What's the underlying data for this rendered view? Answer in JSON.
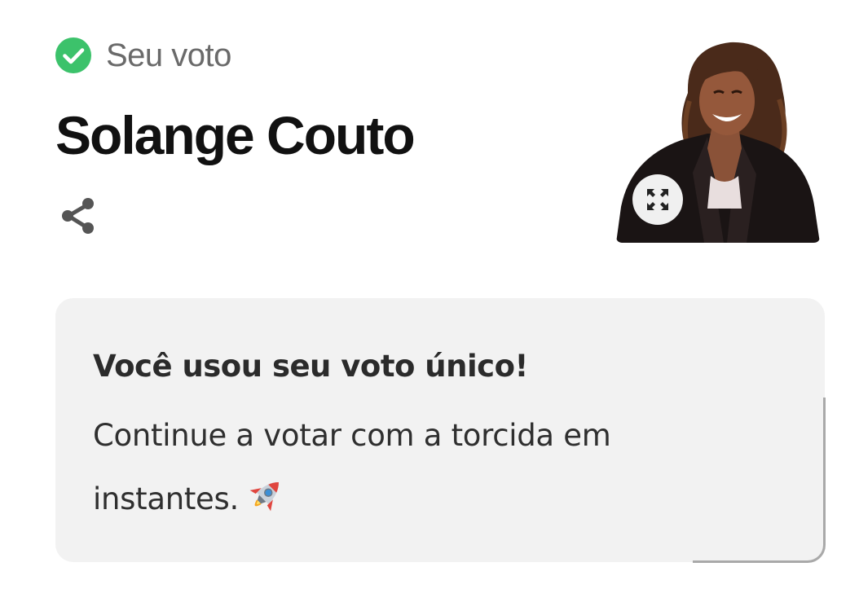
{
  "vote_status": {
    "label": "Seu voto",
    "icon": "check-circle-icon",
    "color": "#3cc26b"
  },
  "candidate": {
    "name": "Solange Couto",
    "photo": "candidate-photo",
    "photo_alt": "Solange Couto"
  },
  "actions": {
    "share_icon": "share-icon",
    "expand_icon": "expand-icon"
  },
  "info_card": {
    "heading": "Você usou seu voto único!",
    "body": "Continue a votar com a torcida em instantes.",
    "emoji": "rocket-icon",
    "background": "#f2f2f2"
  }
}
